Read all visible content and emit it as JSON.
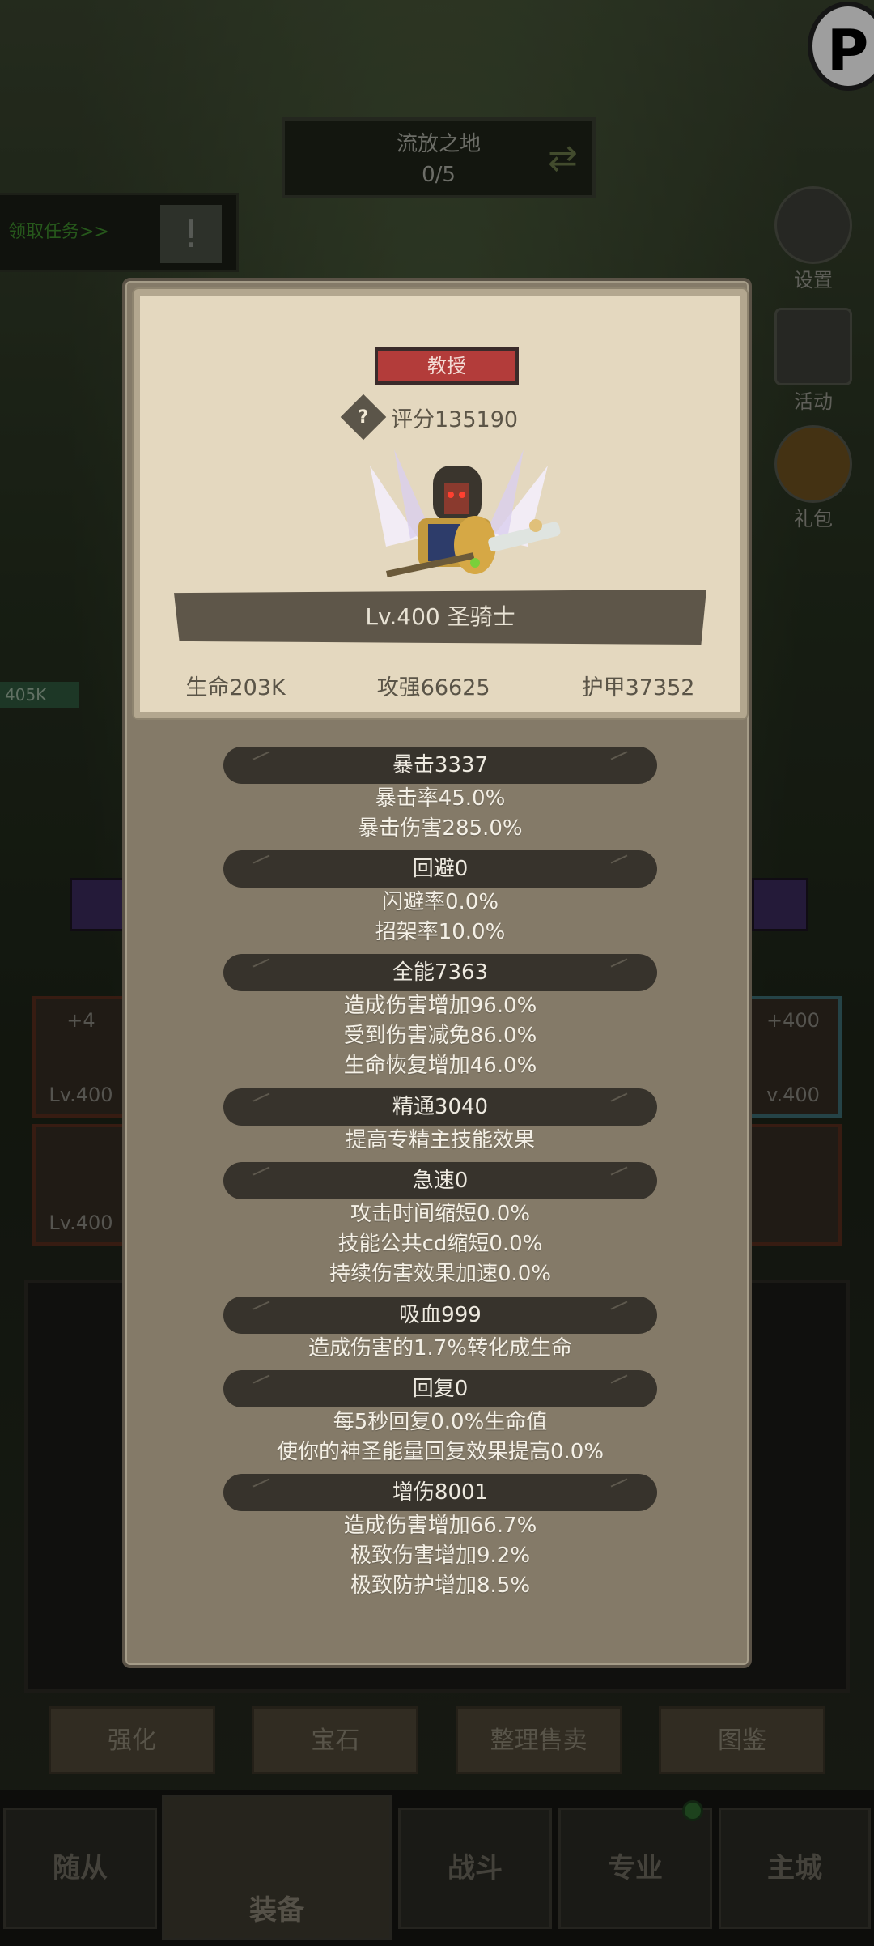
{
  "background": {
    "location_title": "流放之地",
    "location_progress": "0/5",
    "quest_link": "领取任务>>",
    "quest_alert": "!",
    "top_right_logo": "P",
    "side_buttons": [
      {
        "label": "设置",
        "icon": "gear-icon"
      },
      {
        "label": "活动",
        "icon": "scroll-icon"
      },
      {
        "label": "礼包",
        "icon": "gift-icon"
      }
    ],
    "hp_tag": "405K",
    "equip_left": [
      {
        "bonus": "+4",
        "level": "Lv.400"
      },
      {
        "bonus": "",
        "level": "Lv.400"
      }
    ],
    "equip_right": [
      {
        "bonus": "+400",
        "level": "v.400"
      },
      {
        "bonus": "",
        "level": ""
      }
    ],
    "action_buttons": [
      "强化",
      "宝石",
      "整理售卖",
      "图鉴"
    ],
    "tabs": [
      "随从",
      "装备",
      "战斗",
      "专业",
      "主城"
    ]
  },
  "modal": {
    "title_badge": "教授",
    "score_label": "评分135190",
    "score_help": "?",
    "hero_name": "Lv.400 圣骑士",
    "stats": [
      "生命203K",
      "攻强66625",
      "护甲37352"
    ],
    "sections": [
      {
        "head": "暴击3337",
        "lines": [
          "暴击率45.0%",
          "暴击伤害285.0%"
        ]
      },
      {
        "head": "回避0",
        "lines": [
          "闪避率0.0%",
          "招架率10.0%"
        ]
      },
      {
        "head": "全能7363",
        "lines": [
          "造成伤害增加96.0%",
          "受到伤害减免86.0%",
          "生命恢复增加46.0%"
        ]
      },
      {
        "head": "精通3040",
        "lines": [
          "提高专精主技能效果"
        ]
      },
      {
        "head": "急速0",
        "lines": [
          "攻击时间缩短0.0%",
          "技能公共cd缩短0.0%",
          "持续伤害效果加速0.0%"
        ]
      },
      {
        "head": "吸血999",
        "lines": [
          "造成伤害的1.7%转化成生命"
        ]
      },
      {
        "head": "回复0",
        "lines": [
          "每5秒回复0.0%生命值",
          "使你的神圣能量回复效果提高0.0%"
        ]
      },
      {
        "head": "增伤8001",
        "lines": [
          "造成伤害增加66.7%",
          "极致伤害增加9.2%",
          "极致防护增加8.5%"
        ]
      }
    ]
  },
  "colors": {
    "modal_bg": "#847a68",
    "card_bg": "#e4d8bf",
    "badge_red": "#b33c3a",
    "section_head": "#37332c"
  }
}
